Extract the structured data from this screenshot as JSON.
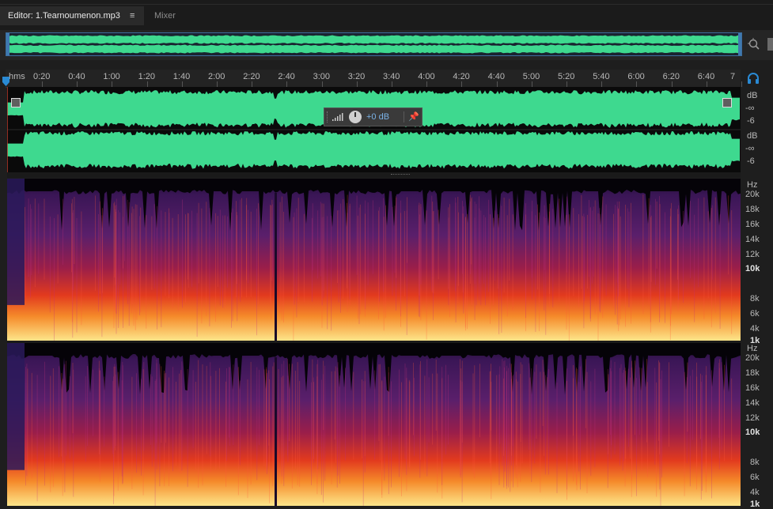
{
  "tabs": {
    "editor_label": "Editor: 1.Tearnoumenon.mp3",
    "menu_glyph": "≡",
    "mixer_label": "Mixer"
  },
  "ruler": {
    "unit_label": "hms",
    "ticks": [
      "0:20",
      "0:40",
      "1:00",
      "1:20",
      "1:40",
      "2:00",
      "2:20",
      "2:40",
      "3:00",
      "3:20",
      "3:40",
      "4:00",
      "4:20",
      "4:40",
      "5:00",
      "5:20",
      "5:40",
      "6:00",
      "6:20",
      "6:40",
      "7"
    ]
  },
  "hud": {
    "gain_value": "+0 dB"
  },
  "amplitude_scale": {
    "channel1": {
      "unit": "dB",
      "inf": "-∞",
      "minus6": "-6"
    },
    "channel2": {
      "unit": "dB",
      "inf": "-∞",
      "minus6": "-6"
    }
  },
  "frequency_scale": {
    "unit": "Hz",
    "labels": [
      "20k",
      "18k",
      "16k",
      "14k",
      "12k",
      "10k",
      "8k",
      "6k",
      "4k",
      "1k"
    ],
    "bold_labels": [
      "10k",
      "1k"
    ]
  },
  "colors": {
    "waveform": "#3ed98f",
    "selection_border": "#3c6e9e",
    "accent_blue": "#2a8ad4",
    "spectrum_low": "#fde68a",
    "spectrum_mid": "#e23a1e",
    "spectrum_high": "#4a1f6b"
  },
  "icons": [
    "zoom-to-selection-icon",
    "headphones-icon",
    "playhead-icon",
    "fade-in-handle-icon",
    "fade-out-handle-icon",
    "volume-bars-icon",
    "gain-dial-icon",
    "pin-icon",
    "menu-icon"
  ]
}
